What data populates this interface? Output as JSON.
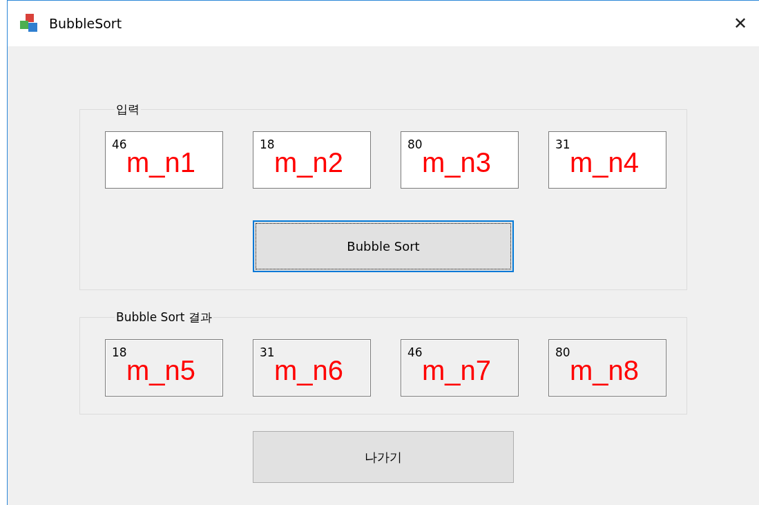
{
  "window": {
    "title": "BubbleSort",
    "close": "✕"
  },
  "groups": [
    {
      "title": "입력",
      "fields": [
        {
          "value": "46",
          "annotation": "m_n1",
          "readonly": false
        },
        {
          "value": "18",
          "annotation": "m_n2",
          "readonly": false
        },
        {
          "value": "80",
          "annotation": "m_n3",
          "readonly": false
        },
        {
          "value": "31",
          "annotation": "m_n4",
          "readonly": false
        }
      ],
      "button": {
        "label": "Bubble Sort",
        "focused": true
      }
    },
    {
      "title": "Bubble Sort 결과",
      "fields": [
        {
          "value": "18",
          "annotation": "m_n5",
          "readonly": true
        },
        {
          "value": "31",
          "annotation": "m_n6",
          "readonly": true
        },
        {
          "value": "46",
          "annotation": "m_n7",
          "readonly": true
        },
        {
          "value": "80",
          "annotation": "m_n8",
          "readonly": true
        }
      ]
    }
  ],
  "exit_button": {
    "label": "나가기",
    "focused": false
  }
}
